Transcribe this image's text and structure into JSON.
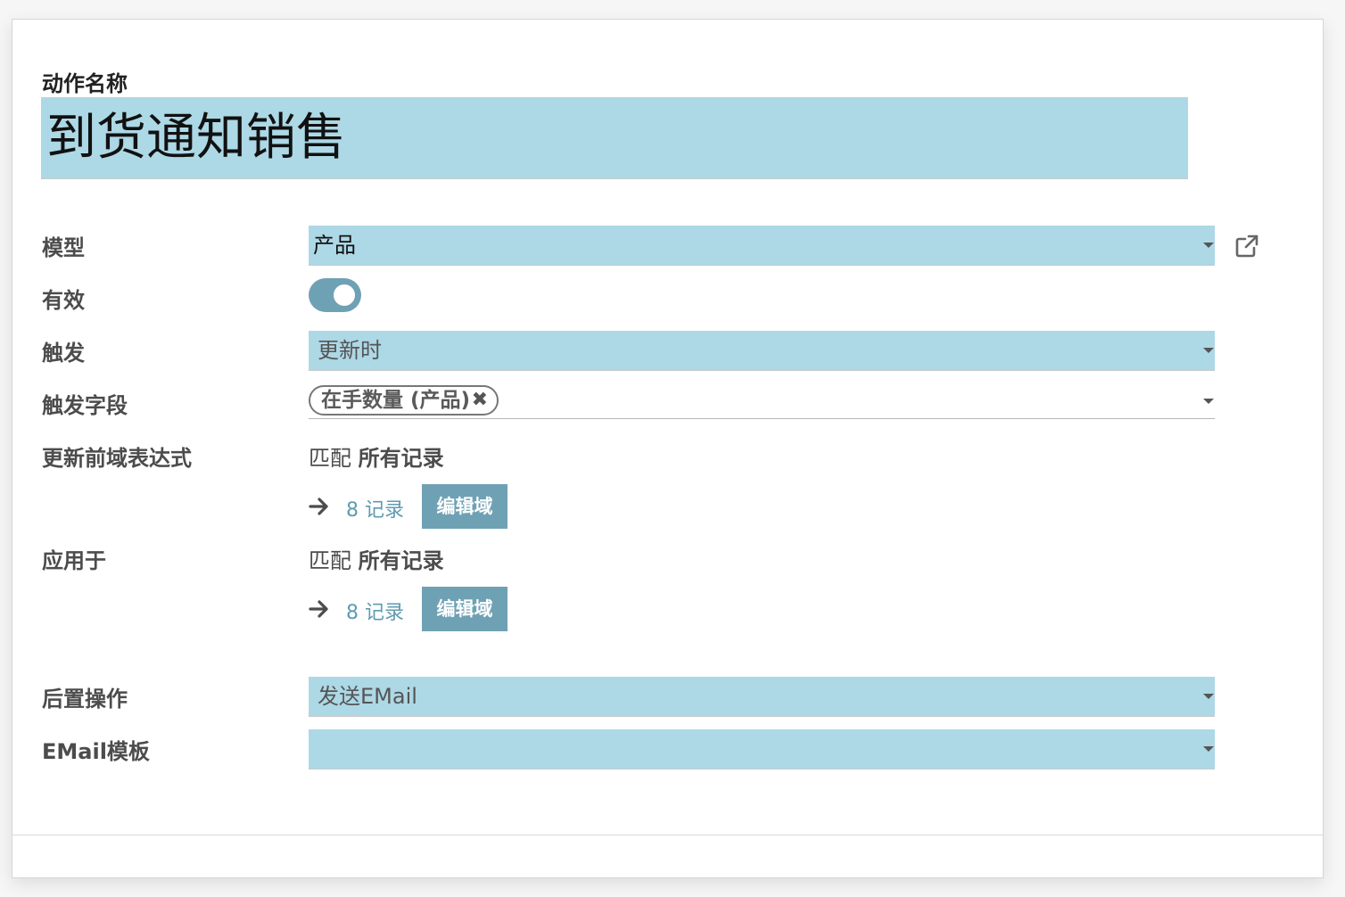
{
  "form": {
    "name_label": "动作名称",
    "name_value": "到货通知销售"
  },
  "fields": {
    "model": {
      "label": "模型",
      "value": "产品"
    },
    "active": {
      "label": "有效",
      "state": "on"
    },
    "trigger": {
      "label": "触发",
      "value": "更新时"
    },
    "trigger_fields": {
      "label": "触发字段",
      "tags": [
        "在手数量 (产品)"
      ],
      "remove_glyph": "✖"
    },
    "before_domain": {
      "label": "更新前域表达式",
      "match_prefix": "匹配",
      "match_scope": "所有记录",
      "records_label": "8 记录",
      "edit_button": "编辑域"
    },
    "apply_on": {
      "label": "应用于",
      "match_prefix": "匹配",
      "match_scope": "所有记录",
      "records_label": "8 记录",
      "edit_button": "编辑域"
    },
    "post_action": {
      "label": "后置操作",
      "value": "发送EMail"
    },
    "email_template": {
      "label": "EMail模板",
      "value": ""
    }
  },
  "colors": {
    "field_bg": "#add8e6",
    "accent": "#6fa1b4",
    "link": "#5f9bb0"
  },
  "icons": {
    "external_link": "external-link-icon",
    "arrow": "arrow-right-icon",
    "caret": "caret-down-icon"
  }
}
